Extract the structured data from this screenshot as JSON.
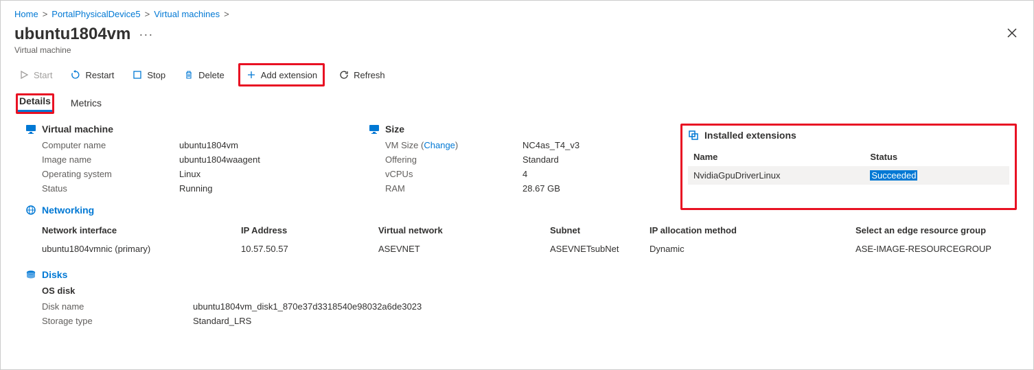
{
  "breadcrumb": {
    "home": "Home",
    "device": "PortalPhysicalDevice5",
    "vms": "Virtual machines"
  },
  "header": {
    "title": "ubuntu1804vm",
    "subtitle": "Virtual machine"
  },
  "toolbar": {
    "start": "Start",
    "restart": "Restart",
    "stop": "Stop",
    "delete": "Delete",
    "add_extension": "Add extension",
    "refresh": "Refresh"
  },
  "tabs": {
    "details": "Details",
    "metrics": "Metrics"
  },
  "sections": {
    "vm": {
      "title": "Virtual machine",
      "rows": {
        "computer_name": {
          "label": "Computer name",
          "value": "ubuntu1804vm"
        },
        "image_name": {
          "label": "Image name",
          "value": "ubuntu1804waagent"
        },
        "os": {
          "label": "Operating system",
          "value": "Linux"
        },
        "status": {
          "label": "Status",
          "value": "Running"
        }
      }
    },
    "size": {
      "title": "Size",
      "rows": {
        "vm_size": {
          "label": "VM Size",
          "change": "Change",
          "value": "NC4as_T4_v3"
        },
        "offering": {
          "label": "Offering",
          "value": "Standard"
        },
        "vcpus": {
          "label": "vCPUs",
          "value": "4"
        },
        "ram": {
          "label": "RAM",
          "value": "28.67 GB"
        }
      }
    },
    "networking": {
      "title": "Networking",
      "headers": {
        "nic": "Network interface",
        "ip": "IP Address",
        "vnet": "Virtual network",
        "subnet": "Subnet",
        "alloc": "IP allocation method",
        "rg": "Select an edge resource group"
      },
      "row": {
        "nic": "ubuntu1804vmnic (primary)",
        "ip": "10.57.50.57",
        "vnet": "ASEVNET",
        "subnet": "ASEVNETsubNet",
        "alloc": "Dynamic",
        "rg": "ASE-IMAGE-RESOURCEGROUP"
      }
    },
    "disks": {
      "title": "Disks",
      "os_disk_title": "OS disk",
      "rows": {
        "disk_name": {
          "label": "Disk name",
          "value": "ubuntu1804vm_disk1_870e37d3318540e98032a6de3023"
        },
        "storage_type": {
          "label": "Storage type",
          "value": "Standard_LRS"
        }
      }
    },
    "extensions": {
      "title": "Installed extensions",
      "headers": {
        "name": "Name",
        "status": "Status"
      },
      "row": {
        "name": "NvidiaGpuDriverLinux",
        "status": "Succeeded"
      }
    }
  }
}
